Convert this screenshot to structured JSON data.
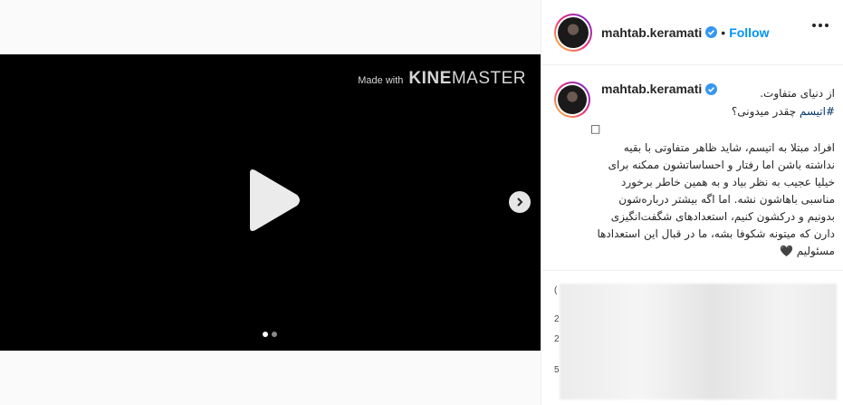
{
  "media": {
    "watermark_small": "Made with",
    "watermark_brand_bold": "KINE",
    "watermark_brand_light": "MASTER",
    "carousel_count": 2,
    "carousel_active_index": 0
  },
  "header": {
    "username": "mahtab.keramati",
    "separator": "•",
    "follow_label": "Follow"
  },
  "caption": {
    "username": "mahtab.keramati",
    "line1": "از دنیای متفاوت.",
    "hashtag": "#اتیسم",
    "line2_rest": " چقدر میدونی؟",
    "box_char": "□",
    "body": "افراد مبتلا به اتیسم، شاید ظاهر متفاوتی با بقیه نداشته باشن اما رفتار و احساساتشون ممکنه برای خیلیا عجیب به نظر بیاد و به همین خاطر برخورد مناسبی باهاشون نشه. اما اگه بیشتر دربارەشون بدونیم و درکشون کنیم، استعدادهای شگفت‌انگیزی دارن که میتونه شکوفا بشه، ما در قبال این استعدادها مسئولیم 🖤"
  },
  "comments": {
    "marks": [
      "(",
      "2",
      "2",
      "5"
    ]
  },
  "colors": {
    "accent": "#0095f6",
    "verified": "#3897f0",
    "video_bg": "#000000"
  }
}
